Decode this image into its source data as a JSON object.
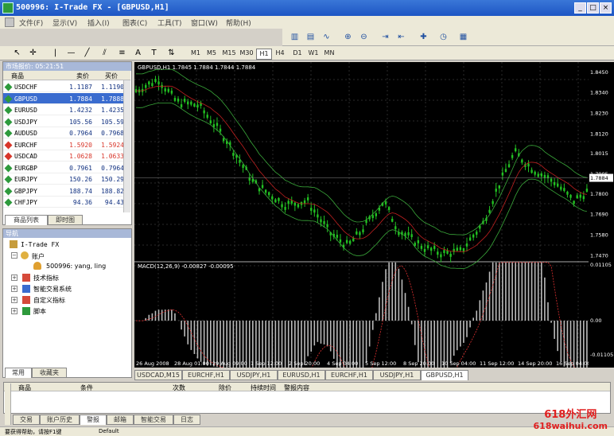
{
  "window": {
    "title": "500996: I-Trade FX - [GBPUSD,H1]"
  },
  "menu": [
    "文件(F)",
    "显示(V)",
    "插入(I)",
    "图表(C)",
    "工具(T)",
    "窗口(W)",
    "帮助(H)"
  ],
  "timeframes": [
    "M1",
    "M5",
    "M15",
    "M30",
    "H1",
    "H4",
    "D1",
    "W1",
    "MN"
  ],
  "selected_timeframe": "H1",
  "market_watch": {
    "title": "市场报价: 05:21:51",
    "col_symbol": "商品",
    "col_bid": "卖价",
    "col_ask": "买价",
    "rows": [
      {
        "symbol": "USDCHF",
        "bid": "1.1187",
        "ask": "1.1190",
        "color": "#2e9a3c"
      },
      {
        "symbol": "GBPUSD",
        "bid": "1.7884",
        "ask": "1.7888",
        "color": "#2e9a3c"
      },
      {
        "symbol": "EURUSD",
        "bid": "1.4232",
        "ask": "1.4235",
        "color": "#2e9a3c"
      },
      {
        "symbol": "USDJPY",
        "bid": "105.56",
        "ask": "105.59",
        "color": "#2e9a3c"
      },
      {
        "symbol": "AUDUSD",
        "bid": "0.7964",
        "ask": "0.7968",
        "color": "#2e9a3c"
      },
      {
        "symbol": "EURCHF",
        "bid": "1.5920",
        "ask": "1.5924",
        "color": "#d8362a"
      },
      {
        "symbol": "USDCAD",
        "bid": "1.0628",
        "ask": "1.0633",
        "color": "#d8362a"
      },
      {
        "symbol": "EURGBP",
        "bid": "0.7961",
        "ask": "0.7964",
        "color": "#2e9a3c"
      },
      {
        "symbol": "EURJPY",
        "bid": "150.26",
        "ask": "150.29",
        "color": "#2e9a3c"
      },
      {
        "symbol": "GBPJPY",
        "bid": "188.74",
        "ask": "188.82",
        "color": "#2e9a3c"
      },
      {
        "symbol": "CHFJPY",
        "bid": "94.36",
        "ask": "94.43",
        "color": "#2e9a3c"
      }
    ],
    "tabs": [
      "商品列表",
      "即时图"
    ]
  },
  "navigator": {
    "title": "导航",
    "root": "I-Trade FX",
    "accounts": "账户",
    "account": "500996: yang, ling",
    "items": [
      "技术指标",
      "智能交易系统",
      "自定义指标",
      "脚本"
    ],
    "tabs": [
      "常用",
      "收藏夹"
    ]
  },
  "chart": {
    "header": "GBPUSD,H1  1.7845 1.7884 1.7844 1.7884",
    "macd_label": "MACD(12,26,9) -0.00827 -0.00095",
    "price_ticks": [
      "1.8450",
      "1.8340",
      "1.8230",
      "1.8120",
      "1.8015",
      "1.7905",
      "1.7884",
      "1.7800",
      "1.7690",
      "1.7580",
      "1.7470"
    ],
    "current_price": "1.7884",
    "macd_ticks": [
      "0.01105",
      "0.00",
      "-0.01105"
    ],
    "time_ticks": [
      "26 Aug 2008",
      "28 Aug 01:00",
      "29 Aug 09:00",
      "1 Sep 12:00",
      "2 Sep 20:00",
      "4 Sep 04:00",
      "5 Sep 12:00",
      "8 Sep 20:00",
      "10 Sep 04:00",
      "11 Sep 12:00",
      "14 Sep 20:00",
      "16 Sep 04:00"
    ],
    "tabs": [
      "USDCAD,M15",
      "EURCHF,H1",
      "USDJPY,H1",
      "EURUSD,H1",
      "EURCHF,H1",
      "USDJPY,H1",
      "GBPUSD,H1"
    ],
    "selected_tab": "GBPUSD,H1"
  },
  "terminal": {
    "columns": [
      "商品",
      "条件",
      "次数",
      "除价",
      "持续时间",
      "警报内容"
    ],
    "tabs": [
      "交易",
      "账户历史",
      "警报",
      "邮箱",
      "智能交易",
      "日志"
    ],
    "selected_tab": "警报"
  },
  "status": {
    "left": "要获得帮助，请按F1键",
    "profile": "Default"
  },
  "watermark": {
    "line1": "618外汇网",
    "line2": "618waihui.com"
  }
}
